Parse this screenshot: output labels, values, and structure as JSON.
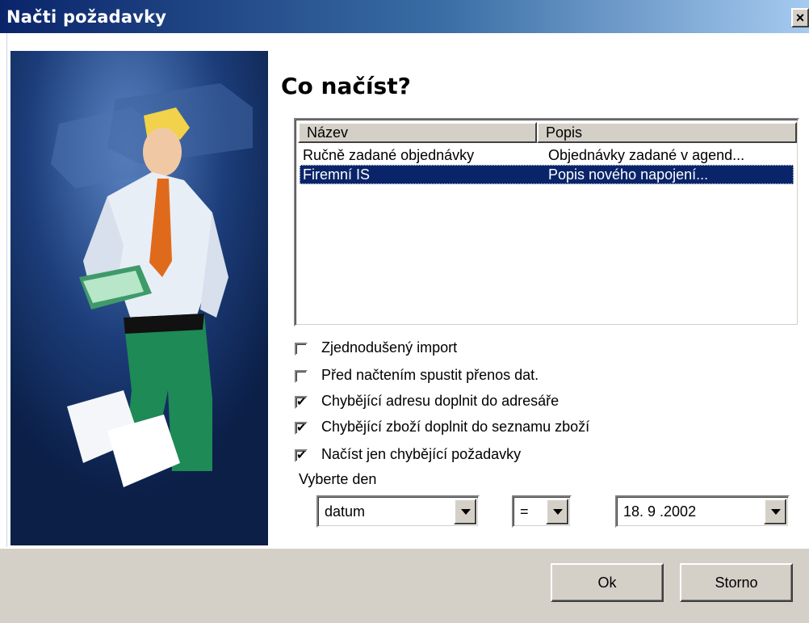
{
  "window": {
    "title": "Načti požadavky",
    "close_glyph": "×"
  },
  "main": {
    "heading": "Co načíst?"
  },
  "list": {
    "columns": [
      "Název",
      "Popis"
    ],
    "rows": [
      {
        "name": "Ručně zadané objednávky",
        "desc": "Objednávky zadané v agend...",
        "selected": false
      },
      {
        "name": "Firemní IS",
        "desc": "Popis nového napojení...",
        "selected": true
      }
    ]
  },
  "options": [
    {
      "label": "Zjednodušený import",
      "checked": false
    },
    {
      "label": "Před načtením spustit přenos dat.",
      "checked": false
    },
    {
      "label": "Chybějící adresu doplnit do adresáře",
      "checked": true
    },
    {
      "label": "Chybějící zboží doplnit do seznamu zboží",
      "checked": true
    },
    {
      "label": "Načíst jen chybějící požadavky",
      "checked": true
    }
  ],
  "day": {
    "label": "Vyberte den",
    "field": "datum",
    "operator": "=",
    "date": "18. 9 .2002"
  },
  "buttons": {
    "ok": "Ok",
    "cancel": "Storno"
  },
  "colors": {
    "selection": "#0a246a",
    "face": "#d4d0c8",
    "title_start": "#0a246a",
    "title_end": "#a6caf0"
  }
}
